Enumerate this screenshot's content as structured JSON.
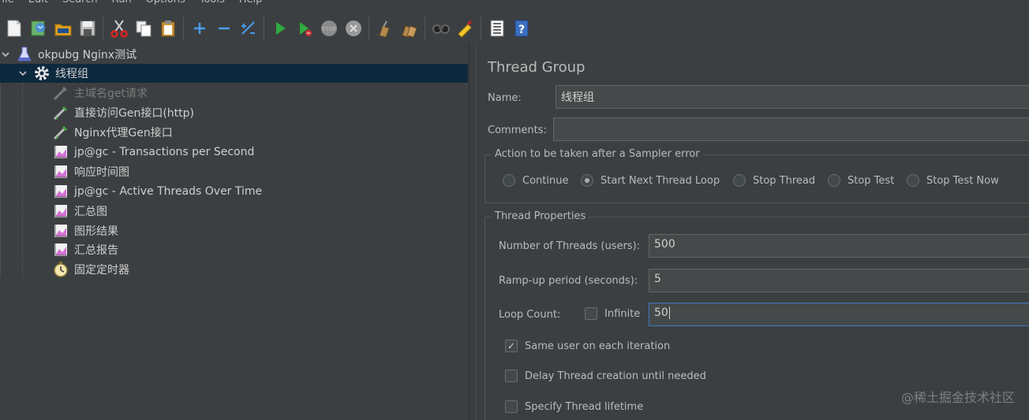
{
  "menu": [
    "File",
    "Edit",
    "Search",
    "Run",
    "Options",
    "Tools",
    "Help"
  ],
  "toolbar": {
    "icons": [
      "new-icon",
      "templates-icon",
      "open-icon",
      "save-icon",
      "cut-icon",
      "copy-icon",
      "paste-icon",
      "expand-icon",
      "collapse-icon",
      "toggle-icon",
      "start-icon",
      "start-no-pauses-icon",
      "stop-icon",
      "shutdown-icon",
      "clear-icon",
      "clear-all-icon",
      "search-icon",
      "reset-search-icon",
      "function-helper-icon",
      "help-icon"
    ]
  },
  "tree": {
    "root": "okpubg Nginx测试",
    "thread_group": "线程组",
    "children": [
      {
        "label": "主域名get请求",
        "icon": "sampler-icon",
        "disabled": true
      },
      {
        "label": "直接访问Gen接口(http)",
        "icon": "sampler-icon",
        "disabled": false
      },
      {
        "label": "Nginx代理Gen接口",
        "icon": "sampler-icon",
        "disabled": false
      },
      {
        "label": "jp@gc - Transactions per Second",
        "icon": "graph-icon",
        "disabled": false
      },
      {
        "label": "响应时间图",
        "icon": "graph-icon",
        "disabled": false
      },
      {
        "label": "jp@gc - Active Threads Over Time",
        "icon": "graph-icon",
        "disabled": false
      },
      {
        "label": "汇总图",
        "icon": "graph-icon",
        "disabled": false
      },
      {
        "label": "图形结果",
        "icon": "graph-icon",
        "disabled": false
      },
      {
        "label": "汇总报告",
        "icon": "graph-icon",
        "disabled": false
      },
      {
        "label": "固定定时器",
        "icon": "timer-icon",
        "disabled": false
      }
    ]
  },
  "panel": {
    "title": "Thread Group",
    "name_label": "Name:",
    "name_value": "线程组",
    "comments_label": "Comments:",
    "comments_value": "",
    "action_section": "Action to be taken after a Sampler error",
    "actions": [
      {
        "label": "Continue",
        "selected": false
      },
      {
        "label": "Start Next Thread Loop",
        "selected": true
      },
      {
        "label": "Stop Thread",
        "selected": false
      },
      {
        "label": "Stop Test",
        "selected": false
      },
      {
        "label": "Stop Test Now",
        "selected": false
      }
    ],
    "thread_section": "Thread Properties",
    "threads_label": "Number of Threads (users):",
    "threads_value": "500",
    "rampup_label": "Ramp-up period (seconds):",
    "rampup_value": "5",
    "loop_label": "Loop Count:",
    "infinite_label": "Infinite",
    "loop_value": "50",
    "same_user_label": "Same user on each iteration",
    "delay_label": "Delay Thread creation until needed",
    "lifetime_label": "Specify Thread lifetime"
  },
  "watermark": "@稀土掘金技术社区",
  "colors": {
    "background": "#3c3f41",
    "selection": "#0d293e",
    "focus_border": "#3d7dbb"
  }
}
